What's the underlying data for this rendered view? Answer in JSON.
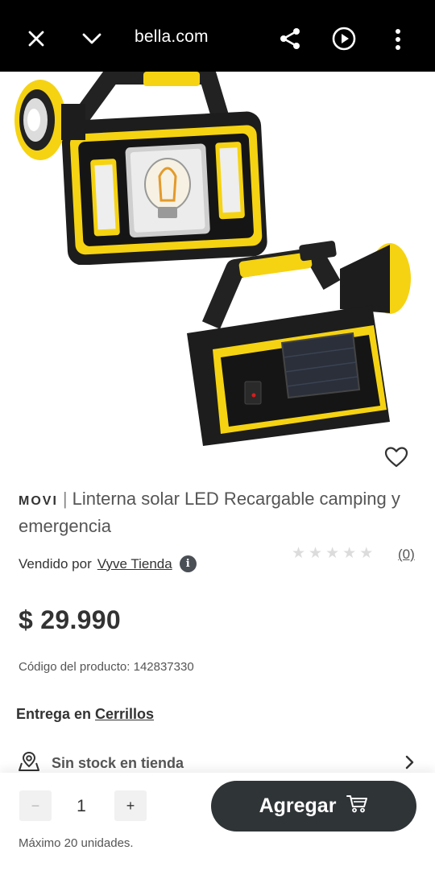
{
  "browser": {
    "url": "bella.com",
    "icons": [
      "close-icon",
      "chevron-down-icon",
      "share-icon",
      "play-icon",
      "more-vertical-icon"
    ]
  },
  "gallery": {
    "favorite_icon": "heart-icon",
    "share_icon": "share-up-icon",
    "slides": 3,
    "active_slide": 1
  },
  "product": {
    "brand": "MOVI",
    "separator": "|",
    "name": "Linterna solar LED Recargable camping y emergencia",
    "seller_prefix": "Vendido por",
    "seller_name": "Vyve Tienda",
    "info_glyph": "i",
    "rating": 0,
    "rating_max": 5,
    "review_count": "(0)",
    "price": "$ 29.990",
    "code": "Código del producto: 142837330"
  },
  "delivery": {
    "label": "Entrega en",
    "location": "Cerrillos"
  },
  "stock": {
    "label": "Sin stock en tienda"
  },
  "purchase": {
    "minus": "−",
    "quantity": "1",
    "plus": "+",
    "add_label": "Agregar",
    "max_note": "Máximo 20 unidades."
  },
  "colors": {
    "topbar": "#000000",
    "accent_yellow": "#f5d312",
    "button_dark": "#2f3437"
  }
}
